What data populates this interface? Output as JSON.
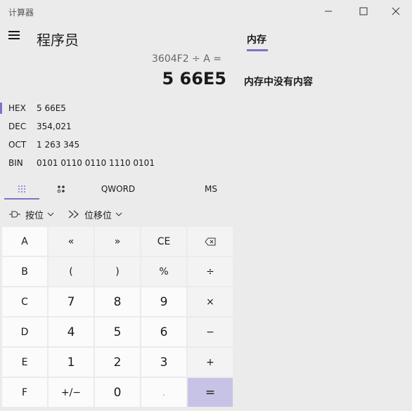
{
  "window": {
    "title": "计算器"
  },
  "header": {
    "mode_title": "程序员"
  },
  "display": {
    "expression": "3604F2 ÷ A =",
    "result": "5 66E5"
  },
  "radix": [
    {
      "label": "HEX",
      "value": "5 66E5",
      "selected": true
    },
    {
      "label": "DEC",
      "value": "354,021"
    },
    {
      "label": "OCT",
      "value": "1 263 345"
    },
    {
      "label": "BIN",
      "value": "0101 0110 0110 1110 0101"
    }
  ],
  "tabs": {
    "word_size": "QWORD",
    "memory_store": "MS"
  },
  "tools": {
    "bitwise": "按位",
    "bitshift": "位移位"
  },
  "keypad": {
    "rows": [
      [
        "A",
        "«",
        "»",
        "CE",
        "⌫"
      ],
      [
        "B",
        "(",
        ")",
        "%",
        "÷"
      ],
      [
        "C",
        "7",
        "8",
        "9",
        "×"
      ],
      [
        "D",
        "4",
        "5",
        "6",
        "−"
      ],
      [
        "E",
        "1",
        "2",
        "3",
        "+"
      ],
      [
        "F",
        "+/−",
        "0",
        ".",
        "="
      ]
    ]
  },
  "memory": {
    "title": "内存",
    "empty_message": "内存中没有内容"
  },
  "colors": {
    "accent": "#7b74c8",
    "equals_bg": "#c6c3e6",
    "background": "#ebebeb"
  },
  "icons": [
    "hamburger-icon",
    "keypad-icon",
    "bit-toggle-icon",
    "bitwise-icon",
    "bitshift-icon",
    "chevron-down-icon",
    "backspace-icon",
    "minimize-icon",
    "maximize-icon",
    "close-icon"
  ]
}
